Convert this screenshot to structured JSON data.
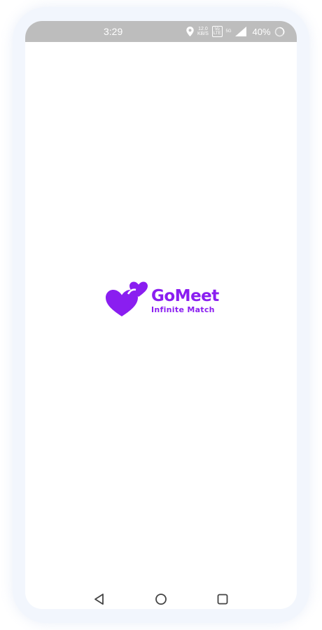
{
  "status_bar": {
    "time": "3:29",
    "net_speed_value": "12.0",
    "net_speed_unit": "KB/S",
    "volte_label": "Vo\nLTE",
    "network_type": "5G",
    "battery_percent": "40%",
    "icons": [
      "location-icon",
      "signal-icon",
      "battery-ring-icon"
    ]
  },
  "splash": {
    "app_name": "GoMeet",
    "tagline": "Infinite Match",
    "brand_color": "#8a1ef0",
    "logo_icon": "double-heart-icon"
  },
  "nav_bar": {
    "icons": [
      "back-triangle-icon",
      "home-circle-icon",
      "recents-square-icon"
    ]
  },
  "colors": {
    "status_bar_bg": "#bdbdbd",
    "screen_bg": "#ffffff",
    "frame_bg": "#f2f6fd",
    "nav_icon": "#444444"
  }
}
